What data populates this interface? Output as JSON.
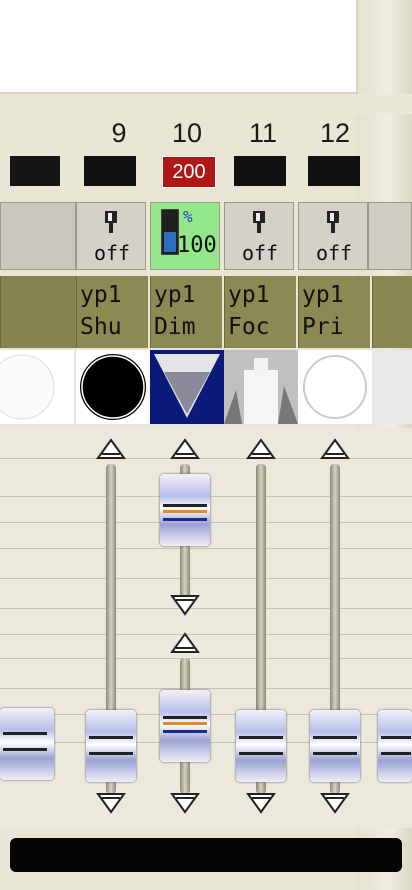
{
  "channels": [
    {
      "number": "9",
      "value": "",
      "switch_label": "off",
      "name_line1": "yp1",
      "name_line2": "Shu",
      "icon": "shutter-icon"
    },
    {
      "number": "10",
      "value": "200",
      "switch_label": "100",
      "switch_unit": "%",
      "name_line1": "yp1",
      "name_line2": "Dim",
      "icon": "dimmer-icon",
      "active": true
    },
    {
      "number": "11",
      "value": "",
      "switch_label": "off",
      "name_line1": "yp1",
      "name_line2": "Foc",
      "icon": "focus-icon"
    },
    {
      "number": "12",
      "value": "",
      "switch_label": "off",
      "name_line1": "yp1",
      "name_line2": "Pri",
      "icon": "prism-icon"
    }
  ],
  "colors": {
    "active_value_bg": "#b01818",
    "active_switch_bg": "#93e68a",
    "name_bg": "#8c8a52",
    "dimmer_bg": "#0a1a7a"
  },
  "faders": {
    "ch10_upper_level": 0.75,
    "ch10_lower_level": 0.25,
    "others_level": 0.0
  }
}
